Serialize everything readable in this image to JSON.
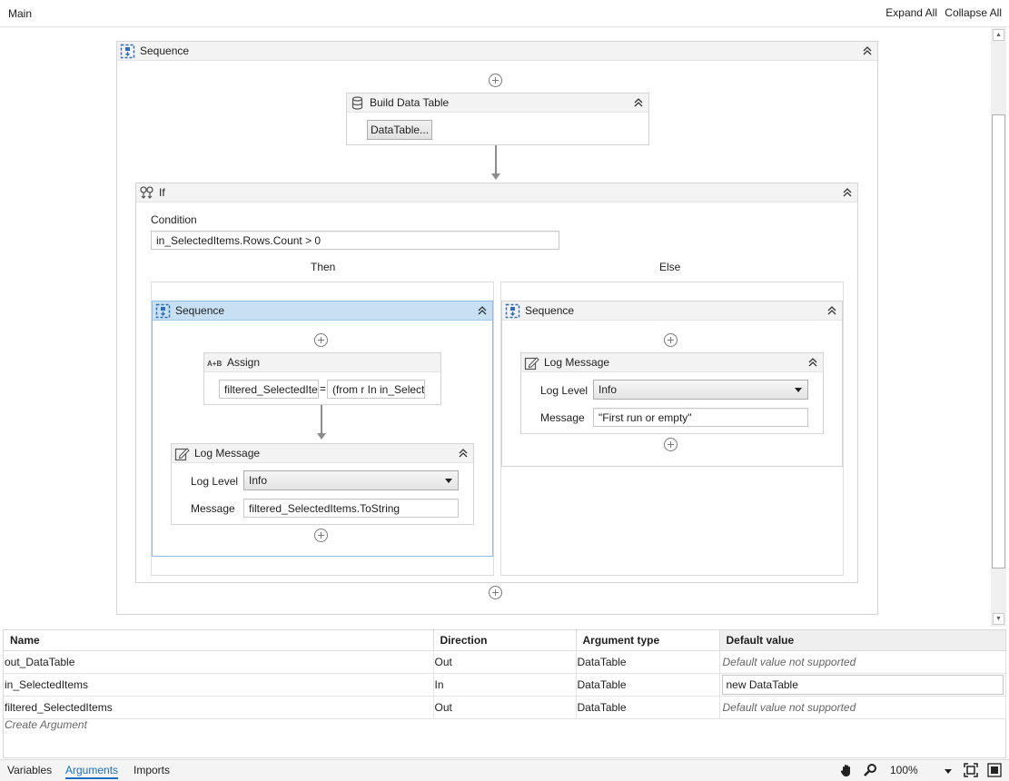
{
  "header": {
    "breadcrumb": "Main",
    "expand_all": "Expand All",
    "collapse_all": "Collapse All"
  },
  "workflow": {
    "root_sequence": {
      "title": "Sequence"
    },
    "build_data_table": {
      "title": "Build Data Table",
      "button_label": "DataTable..."
    },
    "if_activity": {
      "title": "If",
      "condition_label": "Condition",
      "condition_value": "in_SelectedItems.Rows.Count > 0",
      "then_label": "Then",
      "else_label": "Else"
    },
    "then_sequence": {
      "title": "Sequence",
      "assign": {
        "title": "Assign",
        "to_value": "filtered_SelectedIte",
        "equals": "=",
        "value": "(from r In in_Select"
      },
      "log_message": {
        "title": "Log Message",
        "log_level_label": "Log Level",
        "log_level_value": "Info",
        "message_label": "Message",
        "message_value": "filtered_SelectedItems.ToString"
      }
    },
    "else_sequence": {
      "title": "Sequence",
      "log_message": {
        "title": "Log Message",
        "log_level_label": "Log Level",
        "log_level_value": "Info",
        "message_label": "Message",
        "message_value": "\"First run or empty\""
      }
    }
  },
  "arguments": {
    "columns": [
      "Name",
      "Direction",
      "Argument type",
      "Default value"
    ],
    "rows": [
      {
        "name": "out_DataTable",
        "direction": "Out",
        "type": "DataTable",
        "default": "Default value not supported"
      },
      {
        "name": "in_SelectedItems",
        "direction": "In",
        "type": "DataTable",
        "default": "new DataTable"
      },
      {
        "name": "filtered_SelectedItems",
        "direction": "Out",
        "type": "DataTable",
        "default": "Default value not supported"
      }
    ],
    "create_label": "Create Argument"
  },
  "statusbar": {
    "tabs": [
      "Variables",
      "Arguments",
      "Imports"
    ],
    "active_tab": "Arguments",
    "zoom": "100%",
    "accent_color": "#1e6fc2"
  }
}
